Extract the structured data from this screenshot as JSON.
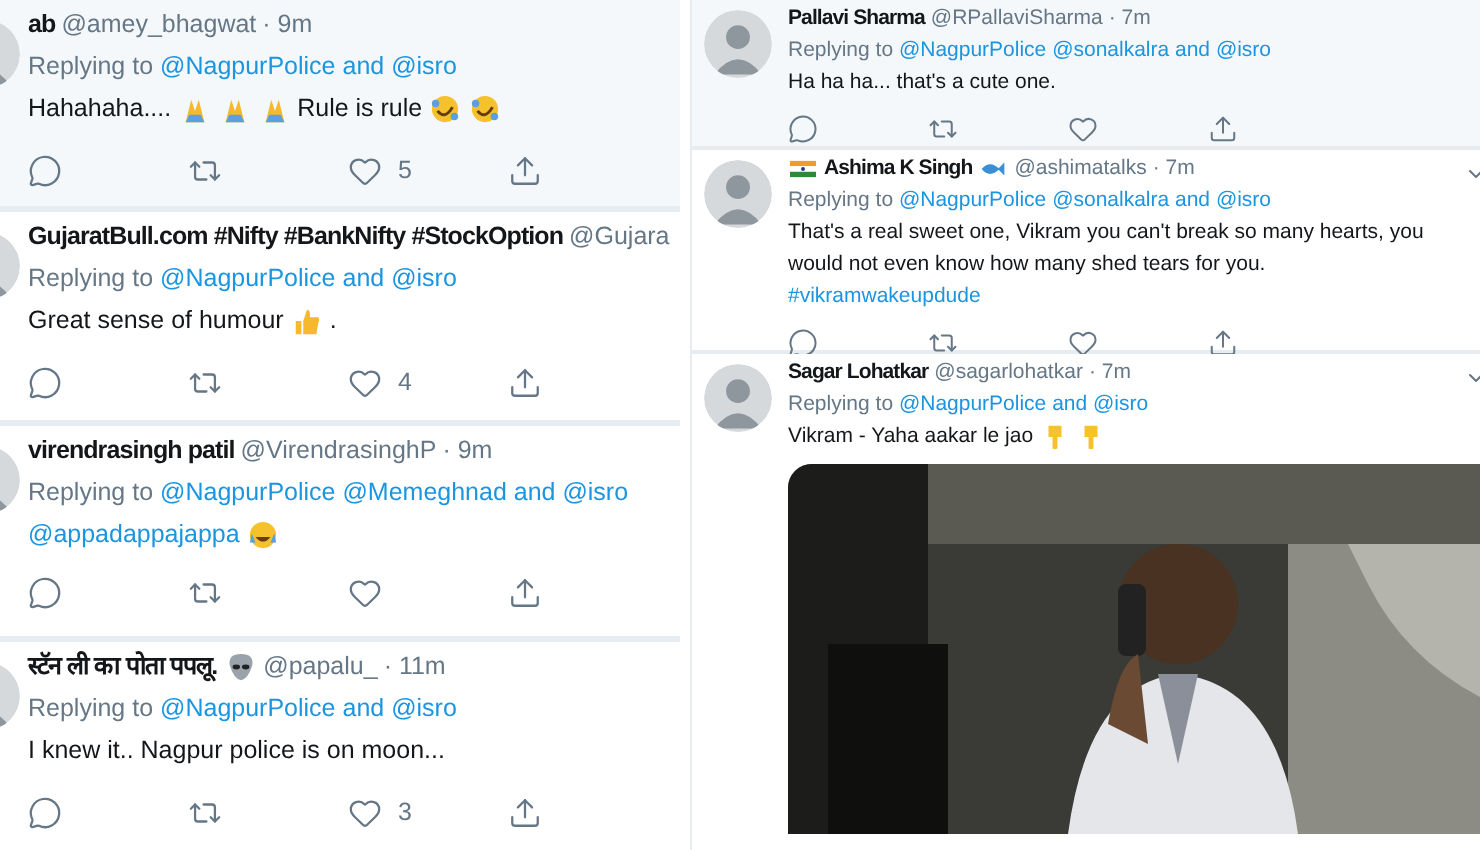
{
  "left_column": [
    {
      "name": "ab",
      "handle": "@amey_bhagwat",
      "time": "· 9m",
      "reply_prefix": "Replying to",
      "reply_to": "@NagpurPolice and @isro",
      "body": [
        {
          "kind": "text",
          "text": "Hahahaha...."
        },
        {
          "kind": "pray"
        },
        {
          "kind": "pray"
        },
        {
          "kind": "pray"
        },
        {
          "kind": "text",
          "text": "Rule is rule"
        },
        {
          "kind": "rofl"
        },
        {
          "kind": "rofl"
        }
      ],
      "likes": "5"
    },
    {
      "name": "GujaratBull.com #Nifty #BankNifty #StockOption",
      "handle": "@Gujara",
      "reply_prefix": "Replying to",
      "reply_to": "@NagpurPolice and @isro",
      "body": [
        {
          "kind": "text",
          "text": "Great sense of humour"
        },
        {
          "kind": "thumbs"
        },
        {
          "kind": "text",
          "text": "."
        }
      ],
      "likes": "4"
    },
    {
      "name": "virendrasingh patil",
      "handle": "@VirendrasinghP",
      "time": "· 9m",
      "reply_prefix": "Replying to",
      "reply_to": "@NagpurPolice @Memeghnad and @isro",
      "body": [
        {
          "kind": "link",
          "text": "@appadappajappa"
        },
        {
          "kind": "joy"
        }
      ]
    },
    {
      "name": "स्टॅन ली का पोता पपलू.",
      "name_badges_after": [
        {
          "kind": "alien"
        }
      ],
      "handle": "@papalu_",
      "time": "· 11m",
      "reply_prefix": "Replying to",
      "reply_to": "@NagpurPolice and @isro",
      "body": [
        {
          "kind": "text",
          "text": "I knew it.. Nagpur police is on moon..."
        }
      ],
      "likes": "3"
    }
  ],
  "right_column": [
    {
      "name": "Pallavi Sharma",
      "handle": "@RPallaviSharma",
      "time": "· 7m",
      "reply_prefix": "Replying to",
      "reply_to": "@NagpurPolice @sonalkalra and @isro",
      "body": [
        {
          "kind": "text",
          "text": "Ha ha ha... that's a cute one."
        }
      ]
    },
    {
      "name": "Ashima K Singh",
      "name_badges_before": [
        {
          "kind": "flag"
        }
      ],
      "name_badges_after": [
        {
          "kind": "fish"
        }
      ],
      "handle": "@ashimatalks",
      "time": "· 7m",
      "reply_prefix": "Replying to",
      "reply_to": "@NagpurPolice @sonalkalra and @isro",
      "body": [
        {
          "kind": "text",
          "text": "That's a real sweet one, Vikram you can't break so many hearts, you would not even know how many shed tears for you. "
        },
        {
          "kind": "link",
          "text": "#vikramwakeupdude"
        }
      ]
    },
    {
      "name": "Sagar Lohatkar",
      "handle": "@sagarlohatkar",
      "time": "· 7m",
      "reply_prefix": "Replying to",
      "reply_to": "@NagpurPolice and @isro",
      "body": [
        {
          "kind": "text",
          "text": "Vikram - Yaha aakar le jao"
        },
        {
          "kind": "pointdown"
        },
        {
          "kind": "pointdown"
        }
      ],
      "media": {
        "kind": "picture"
      }
    }
  ]
}
